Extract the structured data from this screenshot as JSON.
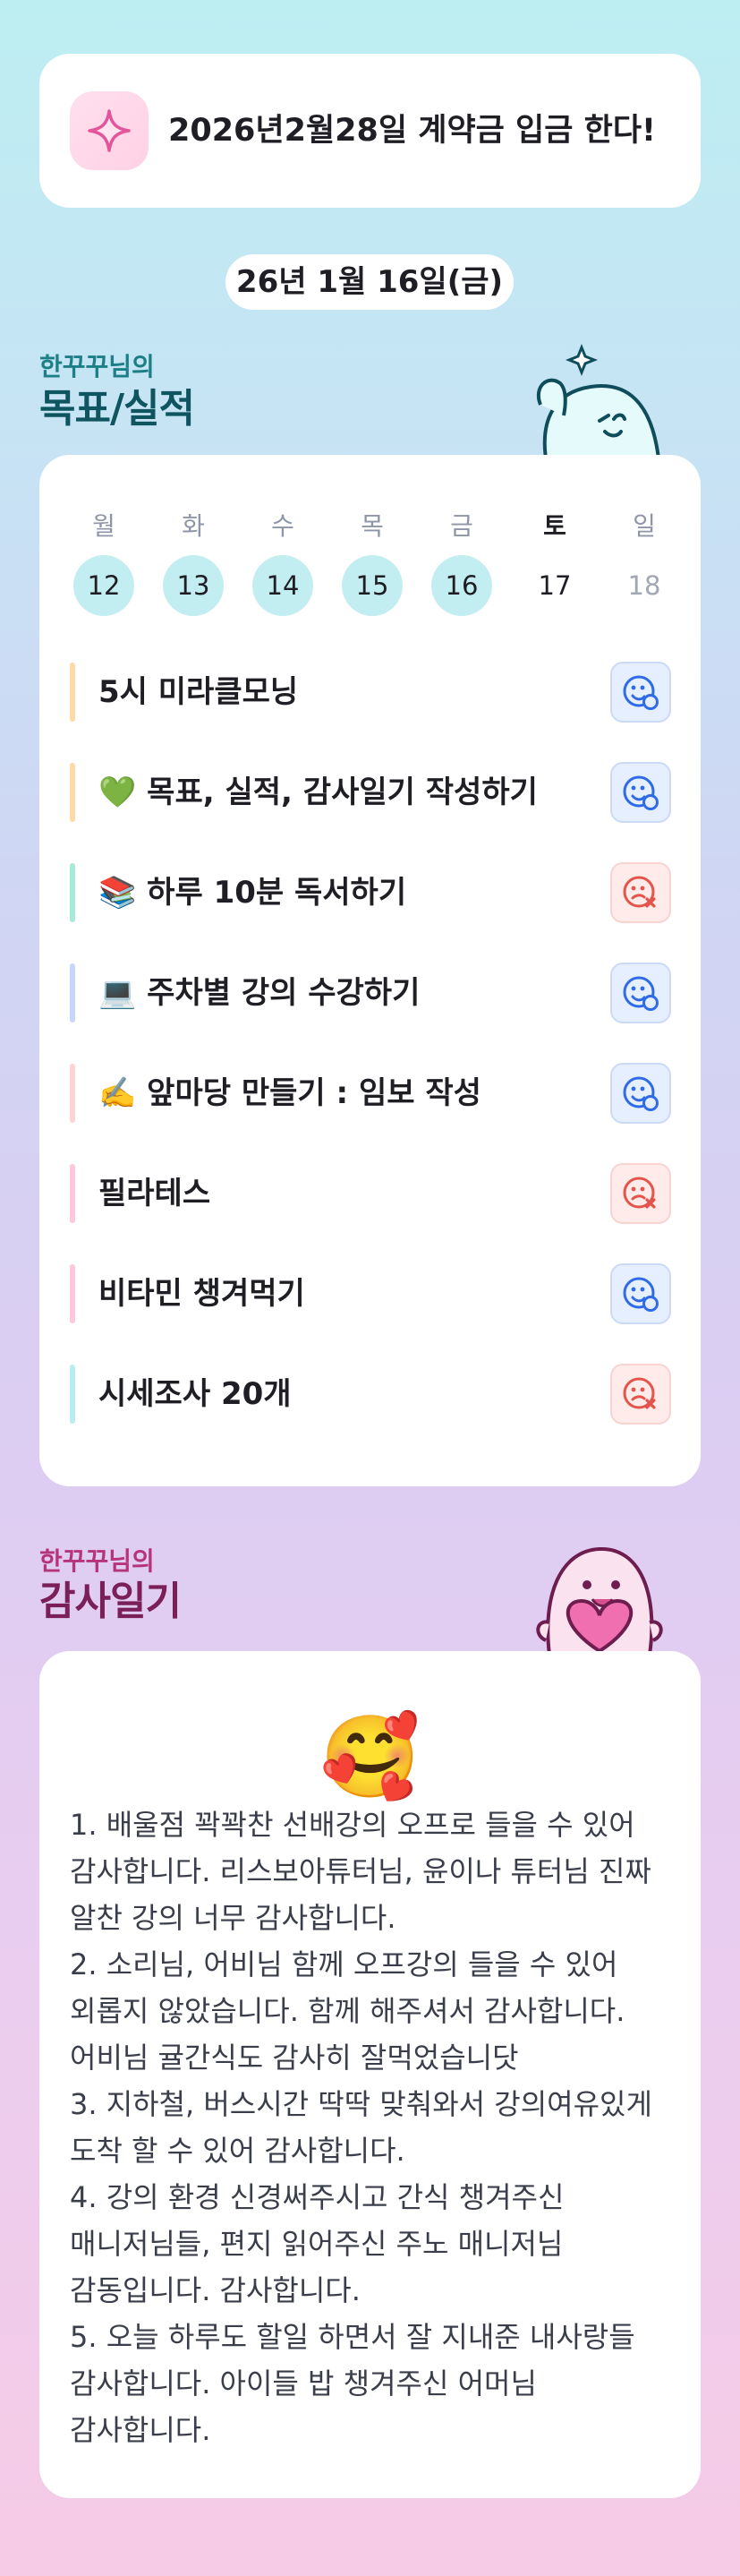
{
  "goal": {
    "icon": "sparkle-icon",
    "text": "2026년2월28일 계약금 입금 한다!"
  },
  "date_pill": "26년 1월 16일(금)",
  "plan_section": {
    "subtitle": "한꾸꾸님의",
    "title": "목표/실적",
    "subtitle_color": "#1d7f86",
    "title_color": "#0f5560"
  },
  "week": {
    "days": [
      {
        "name": "월",
        "num": "12",
        "state": "done"
      },
      {
        "name": "화",
        "num": "13",
        "state": "done"
      },
      {
        "name": "수",
        "num": "14",
        "state": "done"
      },
      {
        "name": "목",
        "num": "15",
        "state": "done"
      },
      {
        "name": "금",
        "num": "16",
        "state": "done"
      },
      {
        "name": "토",
        "num": "17",
        "state": "plain"
      },
      {
        "name": "일",
        "num": "18",
        "state": "muted"
      }
    ]
  },
  "tasks": [
    {
      "label": "5시 미라클모닝",
      "bar": "#ffd9a6",
      "status": "ok"
    },
    {
      "label": "💚 목표, 실적, 감사일기 작성하기",
      "bar": "#ffd9a6",
      "status": "ok"
    },
    {
      "label": "📚 하루 10분 독서하기",
      "bar": "#a6ead9",
      "status": "no"
    },
    {
      "label": "💻 주차별 강의 수강하기",
      "bar": "#c9d6fb",
      "status": "ok"
    },
    {
      "label": "✍️ 앞마당 만들기 : 임보 작성",
      "bar": "#ffd3d3",
      "status": "ok"
    },
    {
      "label": "필라테스",
      "bar": "#ffc6dd",
      "status": "no"
    },
    {
      "label": "비타민 챙겨먹기",
      "bar": "#ffc6dd",
      "status": "ok"
    },
    {
      "label": "시세조사 20개",
      "bar": "#b9eeee",
      "status": "no"
    }
  ],
  "thanks_section": {
    "subtitle": "한꾸꾸님의",
    "title": "감사일기",
    "subtitle_color": "#b6347a",
    "title_color": "#7a1f57"
  },
  "thanks": {
    "emoji": "🥰",
    "body": "1. 배울점 꽉꽉찬 선배강의 오프로 들을 수 있어 감사합니다. 리스보아튜터님, 윤이나 튜터님 진짜 알찬 강의 너무 감사합니다.\n2. 소리님, 어비님 함께 오프강의 들을 수 있어 외롭지 않았습니다. 함께 해주셔서 감사합니다. 어비님 귤간식도 감사히 잘먹었습니닷\n3. 지하철, 버스시간 딱딱 맞춰와서 강의여유있게 도착 할 수 있어 감사합니다.\n4. 강의 환경 신경써주시고 간식 챙겨주신 매니저님들, 편지 읽어주신 주노 매니저님 감동입니다. 감사합니다.\n5. 오늘 하루도 할일 하면서 잘 지내준 내사랑들 감사합니다. 아이들 밥 챙겨주신 어머님 감사합니다."
  }
}
